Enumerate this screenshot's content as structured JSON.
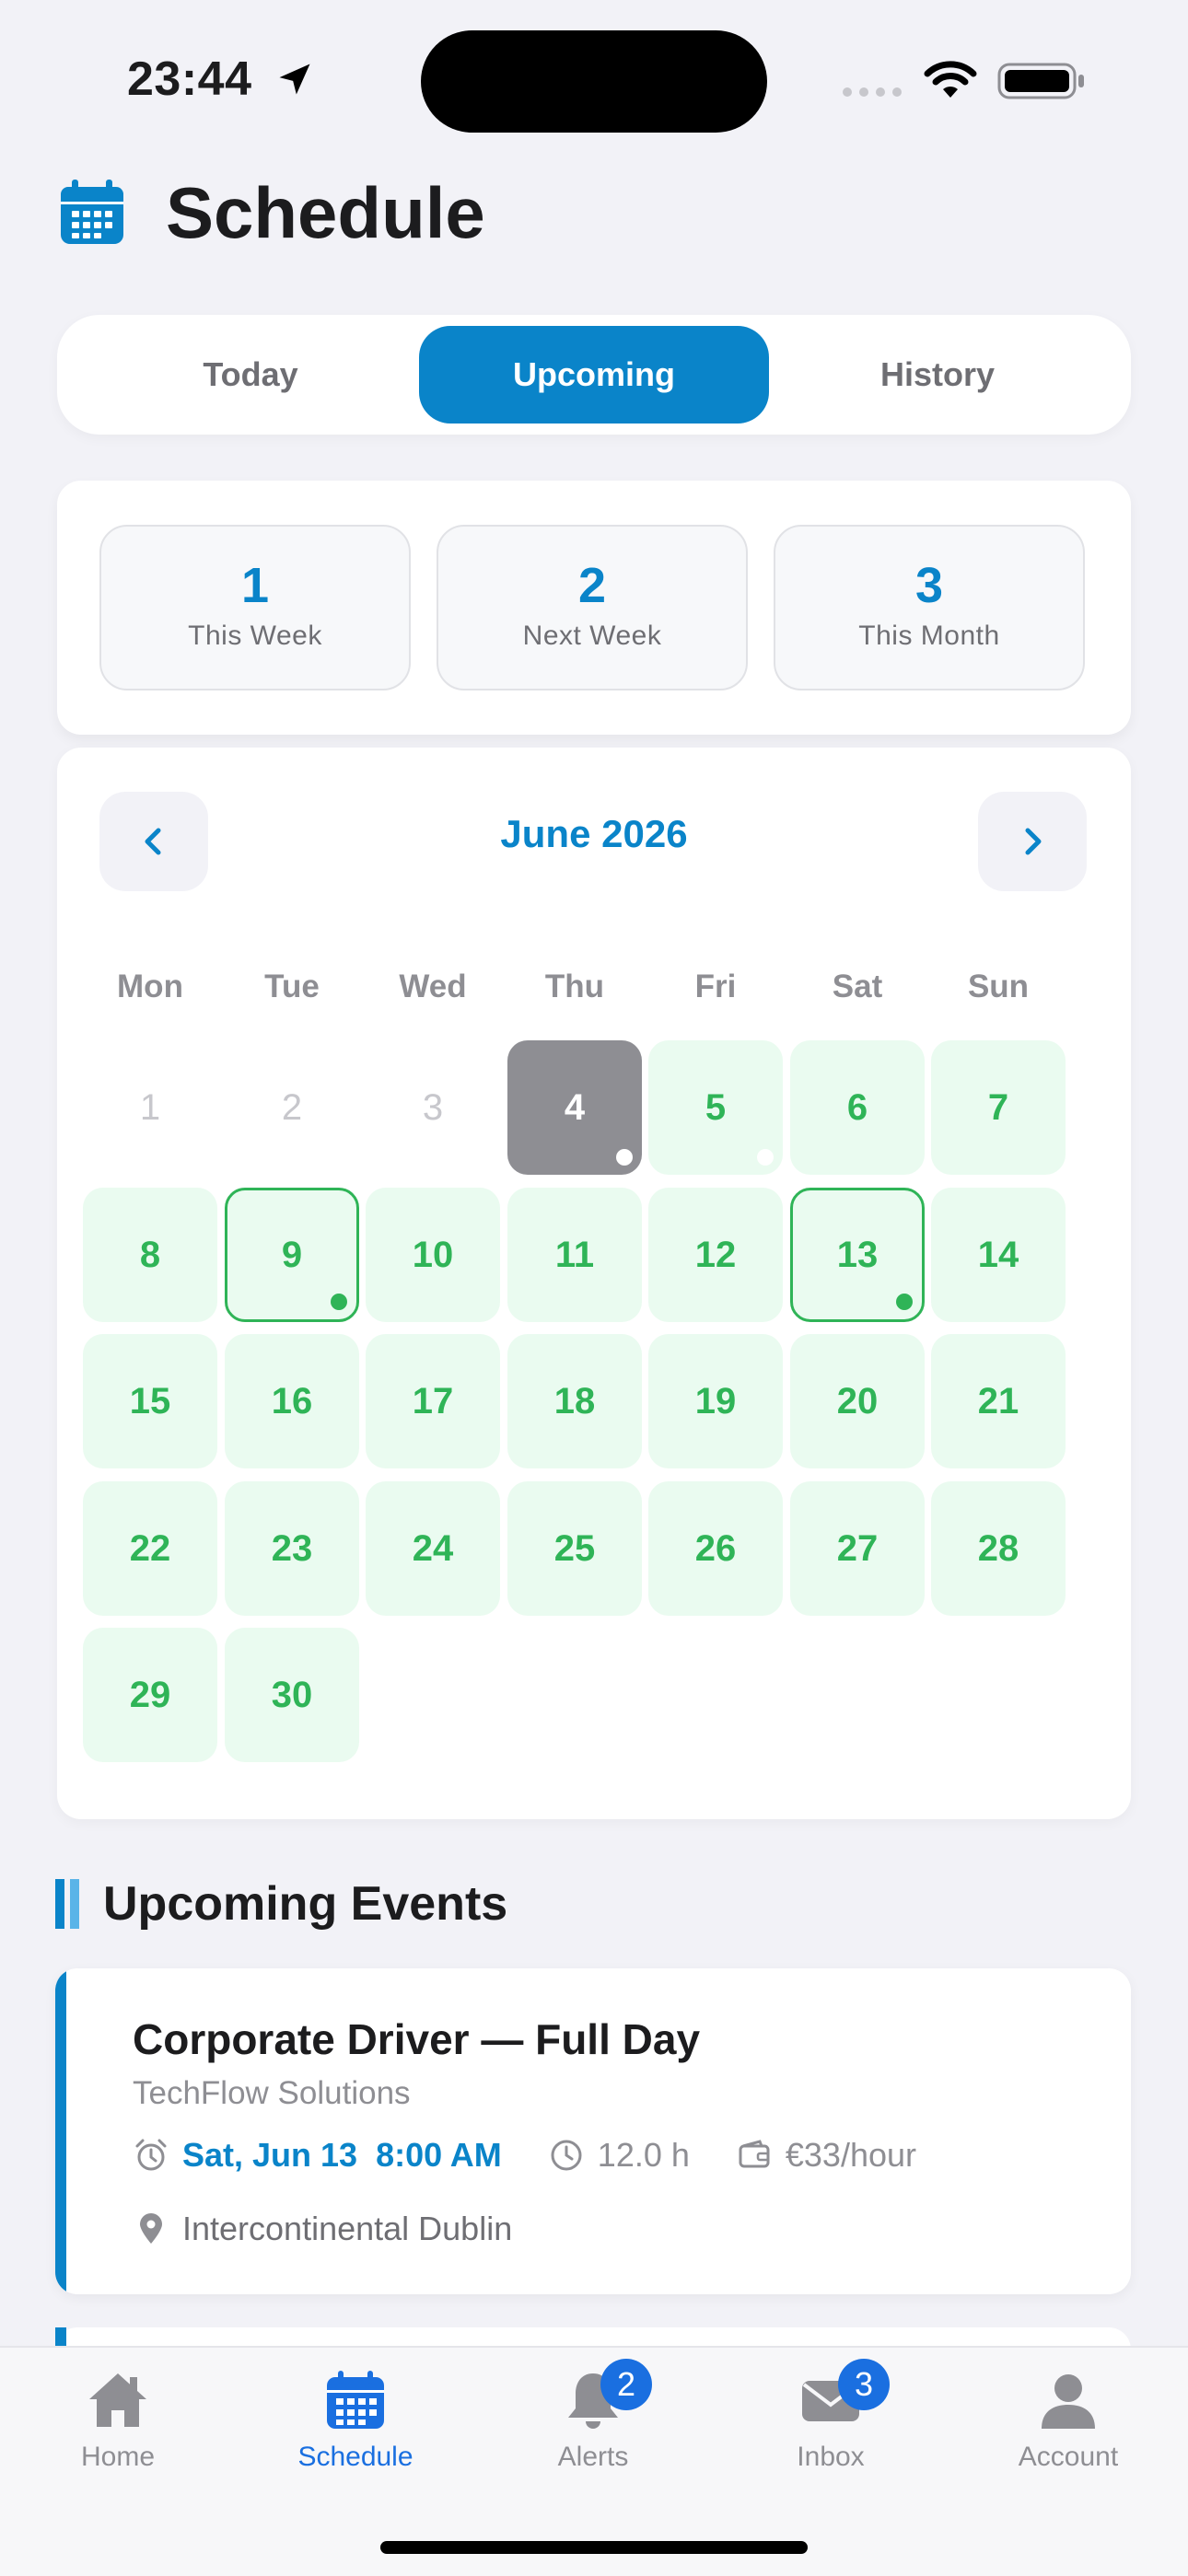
{
  "status_bar": {
    "time": "23:44"
  },
  "header": {
    "title": "Schedule"
  },
  "segments": [
    "Today",
    "Upcoming",
    "History"
  ],
  "active_segment": "Upcoming",
  "stats": [
    {
      "value": "1",
      "label": "This Week"
    },
    {
      "value": "2",
      "label": "Next Week"
    },
    {
      "value": "3",
      "label": "This Month"
    }
  ],
  "calendar": {
    "month": "June 2026",
    "weekdays": [
      "Mon",
      "Tue",
      "Wed",
      "Thu",
      "Fri",
      "Sat",
      "Sun"
    ],
    "days": [
      {
        "n": "1",
        "state": "past"
      },
      {
        "n": "2",
        "state": "past"
      },
      {
        "n": "3",
        "state": "past"
      },
      {
        "n": "4",
        "state": "today",
        "dot": "white"
      },
      {
        "n": "5",
        "state": "avail",
        "dot": "white"
      },
      {
        "n": "6",
        "state": "avail"
      },
      {
        "n": "7",
        "state": "avail"
      },
      {
        "n": "8",
        "state": "avail"
      },
      {
        "n": "9",
        "state": "booked",
        "dot": "green"
      },
      {
        "n": "10",
        "state": "avail"
      },
      {
        "n": "11",
        "state": "avail"
      },
      {
        "n": "12",
        "state": "avail"
      },
      {
        "n": "13",
        "state": "booked",
        "dot": "green"
      },
      {
        "n": "14",
        "state": "avail"
      },
      {
        "n": "15",
        "state": "avail"
      },
      {
        "n": "16",
        "state": "avail"
      },
      {
        "n": "17",
        "state": "avail"
      },
      {
        "n": "18",
        "state": "avail"
      },
      {
        "n": "19",
        "state": "avail"
      },
      {
        "n": "20",
        "state": "avail"
      },
      {
        "n": "21",
        "state": "avail"
      },
      {
        "n": "22",
        "state": "avail"
      },
      {
        "n": "23",
        "state": "avail"
      },
      {
        "n": "24",
        "state": "avail"
      },
      {
        "n": "25",
        "state": "avail"
      },
      {
        "n": "26",
        "state": "avail"
      },
      {
        "n": "27",
        "state": "avail"
      },
      {
        "n": "28",
        "state": "avail"
      },
      {
        "n": "29",
        "state": "avail"
      },
      {
        "n": "30",
        "state": "avail"
      }
    ]
  },
  "upcoming": {
    "title": "Upcoming Events",
    "events": [
      {
        "title": "Corporate Driver — Full Day",
        "company": "TechFlow Solutions",
        "date": "Sat, Jun 13",
        "time": "8:00 AM",
        "hours": "12.0 h",
        "rate": "€33/hour",
        "location": "Intercontinental Dublin"
      }
    ]
  },
  "tabs": [
    {
      "label": "Home",
      "icon": "house-icon"
    },
    {
      "label": "Schedule",
      "icon": "calendar-icon"
    },
    {
      "label": "Alerts",
      "icon": "bell-icon",
      "badge": "2"
    },
    {
      "label": "Inbox",
      "icon": "envelope-icon",
      "badge": "3"
    },
    {
      "label": "Account",
      "icon": "person-icon"
    }
  ],
  "active_tab": "Schedule",
  "colors": {
    "accent": "#0a84c9",
    "available_bg": "#eafbf0",
    "available_text": "#2fb457",
    "today_bg": "#8e8e93",
    "tab_active": "#1a6fe0"
  }
}
